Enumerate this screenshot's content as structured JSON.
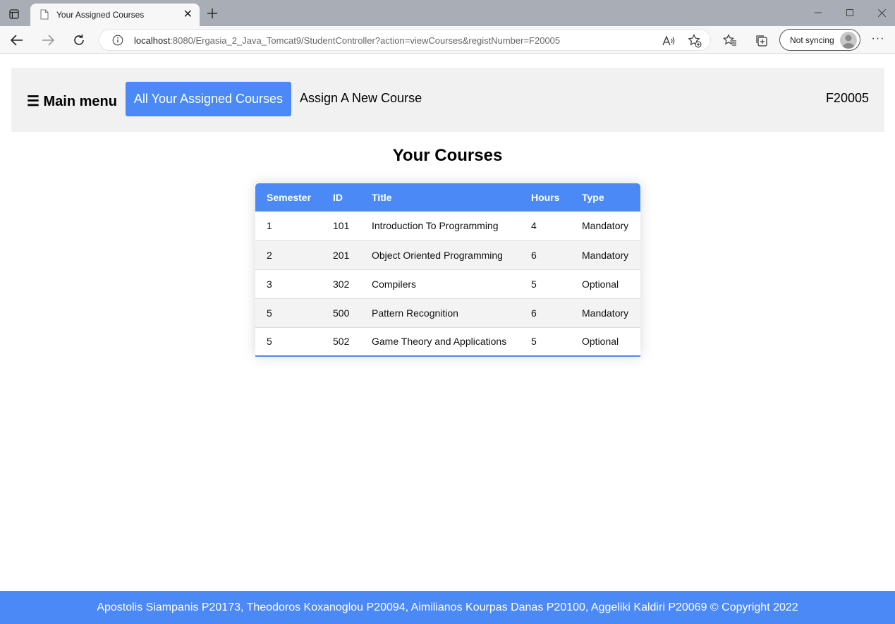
{
  "browser": {
    "tab_title": "Your Assigned Courses",
    "url_host": "localhost",
    "url_rest": ":8080/Ergasia_2_Java_Tomcat9/StudentController?action=viewCourses&registNumber=F20005",
    "sync_label": "Not syncing"
  },
  "nav": {
    "menu_title": "☰ Main menu",
    "active_link": "All Your Assigned Courses",
    "assign_link": "Assign A New Course",
    "user_id": "F20005"
  },
  "main": {
    "heading": "Your Courses",
    "columns": [
      "Semester",
      "ID",
      "Title",
      "Hours",
      "Type"
    ],
    "rows": [
      [
        "1",
        "101",
        "Introduction To Programming",
        "4",
        "Mandatory"
      ],
      [
        "2",
        "201",
        "Object Oriented Programming",
        "6",
        "Mandatory"
      ],
      [
        "3",
        "302",
        "Compilers",
        "5",
        "Optional"
      ],
      [
        "5",
        "500",
        "Pattern Recognition",
        "6",
        "Mandatory"
      ],
      [
        "5",
        "502",
        "Game Theory and Applications",
        "5",
        "Optional"
      ]
    ]
  },
  "footer": {
    "text": "Apostolis Siampanis P20173, Theodoros Koxanoglou P20094, Aimilianos Kourpas Danas P20100, Aggeliki Kaldiri P20069 © Copyright 2022"
  },
  "colors": {
    "accent": "#4a89f6",
    "nav_background": "#f1f1f1"
  }
}
